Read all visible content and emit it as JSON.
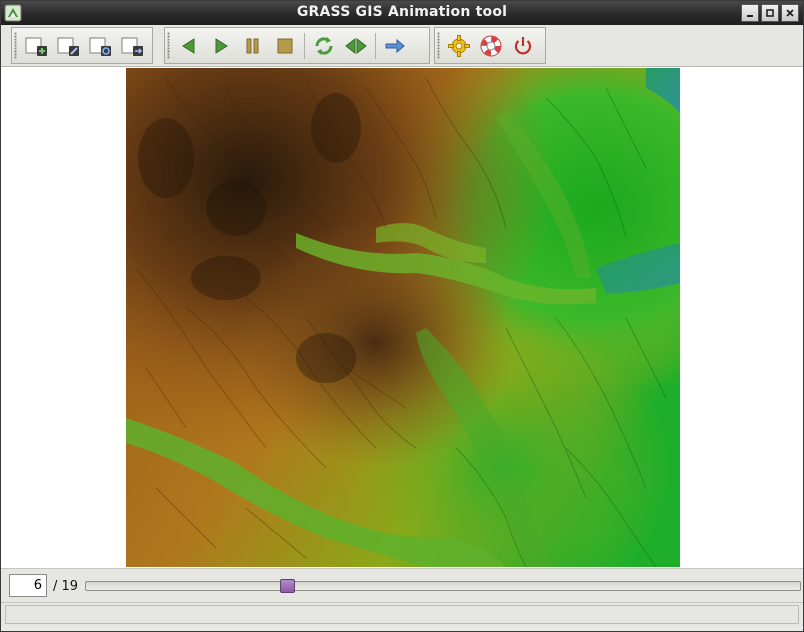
{
  "window": {
    "title": "GRASS GIS Animation tool"
  },
  "toolbar": {
    "groups": [
      {
        "name": "animation-management",
        "buttons": [
          {
            "icon": "add-animation-icon",
            "tooltip": "Add new animation"
          },
          {
            "icon": "edit-animation-icon",
            "tooltip": "Edit animation"
          },
          {
            "icon": "reload-animation-icon",
            "tooltip": "Reload"
          },
          {
            "icon": "export-animation-icon",
            "tooltip": "Export animation"
          }
        ]
      },
      {
        "name": "playback",
        "buttons": [
          {
            "icon": "play-back-icon",
            "tooltip": "Play backwards"
          },
          {
            "icon": "play-forward-icon",
            "tooltip": "Play"
          },
          {
            "icon": "pause-icon",
            "tooltip": "Pause"
          },
          {
            "icon": "stop-icon",
            "tooltip": "Stop"
          },
          {
            "icon": "repeat-icon",
            "tooltip": "Repeat"
          },
          {
            "icon": "bounce-icon",
            "tooltip": "Bounce"
          },
          {
            "icon": "ordering-icon",
            "tooltip": "Direction"
          }
        ]
      },
      {
        "name": "misc",
        "buttons": [
          {
            "icon": "settings-icon",
            "tooltip": "Settings"
          },
          {
            "icon": "help-icon",
            "tooltip": "Help"
          },
          {
            "icon": "quit-icon",
            "tooltip": "Quit"
          }
        ]
      }
    ]
  },
  "frame_control": {
    "current_frame": "6",
    "total_label": "/ 19",
    "slider_fraction": 0.2778
  },
  "statusbar": {
    "text": ""
  },
  "colors": {
    "titlebar": "#2c2c2c",
    "map_green": "#2bb42b",
    "map_brown": "#8a5a1e",
    "slider_handle": "#9a6ab4"
  }
}
